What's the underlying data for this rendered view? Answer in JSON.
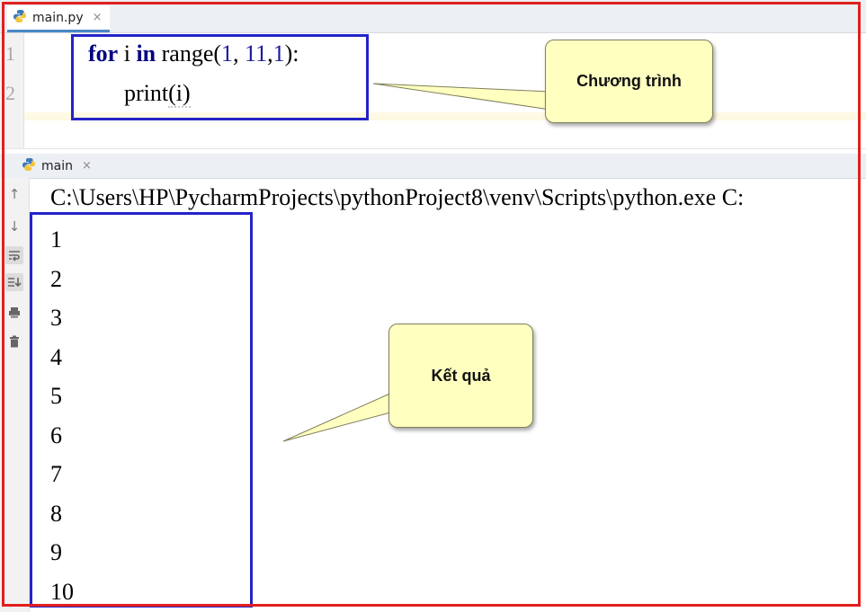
{
  "editor_tab": {
    "filename": "main.py",
    "close": "×"
  },
  "gutter": {
    "line1": "1",
    "line2": "2"
  },
  "code": {
    "line1": {
      "kw_for": "for",
      "var_i": "i",
      "kw_in": "in",
      "fn_range": "range",
      "open": "(",
      "a1": "1",
      "c1": ", ",
      "a2": "11",
      "c2": ",",
      "a3": "1",
      "close": "):"
    },
    "line2": {
      "fn_print": "print",
      "args": "(i)"
    }
  },
  "run_tab": {
    "name": "main",
    "close": "×"
  },
  "console": {
    "command": "C:\\Users\\HP\\PycharmProjects\\pythonProject8\\venv\\Scripts\\python.exe C:",
    "output": [
      "1",
      "2",
      "3",
      "4",
      "5",
      "6",
      "7",
      "8",
      "9",
      "10"
    ]
  },
  "callouts": {
    "program": "Chương trình",
    "result": "Kết quả"
  },
  "icons": [
    "arrow-up-icon",
    "arrow-down-icon",
    "soft-wrap-icon",
    "scroll-to-end-icon",
    "print-icon",
    "trash-icon"
  ],
  "colors": {
    "frame": "#e0201e",
    "highlight_box": "#2424c8",
    "callout_fill": "#ffffc0",
    "keyword": "#000080"
  }
}
